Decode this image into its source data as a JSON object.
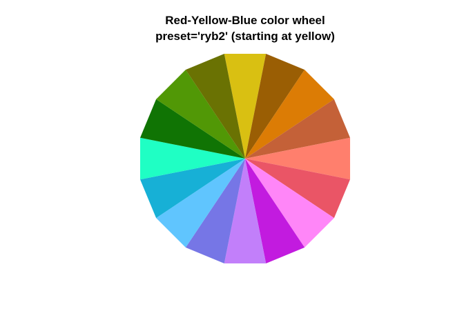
{
  "chart_data": {
    "type": "pie",
    "title": "Red-Yellow-Blue color wheel",
    "subtitle": "preset='ryb2' (starting at yellow)",
    "legend": "none",
    "start": "top",
    "direction": "clockwise",
    "slices": [
      {
        "value": 1,
        "color": "#D9C012"
      },
      {
        "value": 1,
        "color": "#9A5E04"
      },
      {
        "value": 1,
        "color": "#DC7C05"
      },
      {
        "value": 1,
        "color": "#C46138"
      },
      {
        "value": 1,
        "color": "#FF7F6D"
      },
      {
        "value": 1,
        "color": "#EA5566"
      },
      {
        "value": 1,
        "color": "#FF86F8"
      },
      {
        "value": 1,
        "color": "#C21BDF"
      },
      {
        "value": 1,
        "color": "#C27FFA"
      },
      {
        "value": 1,
        "color": "#7676E6"
      },
      {
        "value": 1,
        "color": "#60C5FE"
      },
      {
        "value": 1,
        "color": "#17B0D6"
      },
      {
        "value": 1,
        "color": "#1FFFC4"
      },
      {
        "value": 1,
        "color": "#107404"
      },
      {
        "value": 1,
        "color": "#519806"
      },
      {
        "value": 1,
        "color": "#6A7203"
      }
    ]
  }
}
